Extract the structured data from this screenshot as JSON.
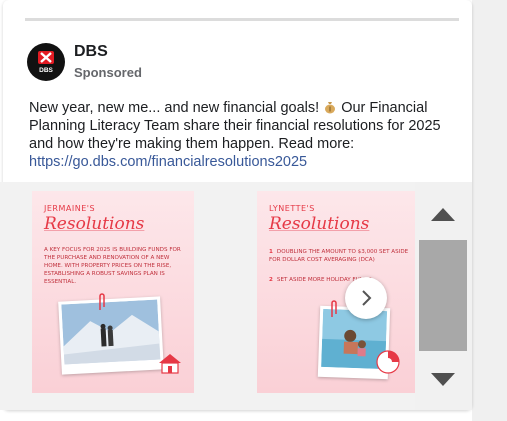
{
  "post": {
    "brand_name": "DBS",
    "avatar_text": "DBS",
    "sponsored_label": "Sponsored",
    "text_before_emoji": "New year, new me... and new financial goals!",
    "emoji_icon": "money-bag-icon",
    "text_after_emoji": " Our Financial Planning Literacy Team share their financial resolutions for 2025 and how they're making them happen. Read more:",
    "link": "https://go.dbs.com/financialresolutions2025"
  },
  "carousel": {
    "slides": [
      {
        "name": "JERMAINE'S",
        "title": "Resolutions",
        "body": "A KEY FOCUS FOR 2025 IS BUILDING FUNDS FOR THE PURCHASE AND RENOVATION OF A NEW HOME. WITH PROPERTY PRICES ON THE RISE, ESTABLISHING A ROBUST SAVINGS PLAN IS ESSENTIAL."
      },
      {
        "name": "LYNETTE'S",
        "title": "Resolutions",
        "items": [
          {
            "num": "1",
            "text": "DOUBLING THE AMOUNT TO $3,000 SET ASIDE FOR DOLLAR COST AVERAGING (DCA)"
          },
          {
            "num": "2",
            "text": "SET ASIDE MORE HOLIDAY FUNDS"
          }
        ]
      }
    ],
    "next_icon": "chevron-right-icon"
  },
  "scrollbar": {
    "up_icon": "triangle-up-icon",
    "down_icon": "triangle-down-icon"
  },
  "colors": {
    "accent_red": "#e63946",
    "link_blue": "#385898",
    "slide_pink": "#fde7ea"
  }
}
